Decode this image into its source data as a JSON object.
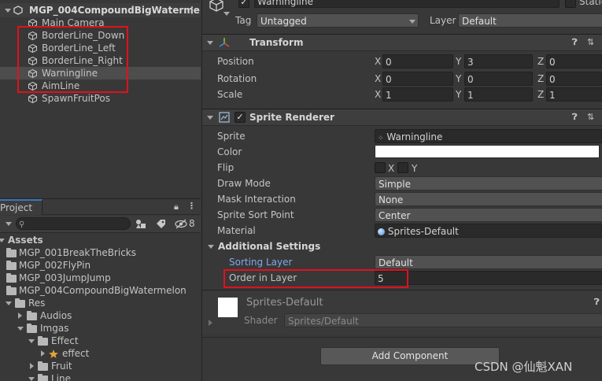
{
  "hierarchy": {
    "root_label": "MGP_004CompoundBigWaterme",
    "items": [
      {
        "label": "Main Camera"
      },
      {
        "label": "BorderLine_Down"
      },
      {
        "label": "BorderLine_Left"
      },
      {
        "label": "BorderLine_Right"
      },
      {
        "label": "Warningline"
      },
      {
        "label": "AimLine"
      },
      {
        "label": "SpawnFruitPos"
      }
    ]
  },
  "project": {
    "tab_label": "Project",
    "search_placeholder": "",
    "badge_count": "8",
    "tree": [
      {
        "label": "Assets"
      },
      {
        "label": "MGP_001BreakTheBricks"
      },
      {
        "label": "MGP_002FlyPin"
      },
      {
        "label": "MGP_003JumpJump"
      },
      {
        "label": "MGP_004CompoundBigWatermelon"
      },
      {
        "label": "Res"
      },
      {
        "label": "Audios"
      },
      {
        "label": "Imgas"
      },
      {
        "label": "Effect"
      },
      {
        "label": "effect"
      },
      {
        "label": "Fruit"
      },
      {
        "label": "Line"
      }
    ]
  },
  "inspector": {
    "object_name": "Warningline",
    "static_label": "Static",
    "tag_label": "Tag",
    "tag_value": "Untagged",
    "layer_label": "Layer",
    "layer_value": "Default",
    "transform": {
      "title": "Transform",
      "rows": [
        {
          "label": "Position",
          "x": "0",
          "y": "3",
          "z": "0"
        },
        {
          "label": "Rotation",
          "x": "0",
          "y": "0",
          "z": "0"
        },
        {
          "label": "Scale",
          "x": "1",
          "y": "1",
          "z": "1"
        }
      ],
      "axis_x": "X",
      "axis_y": "Y",
      "axis_z": "Z"
    },
    "sprite_renderer": {
      "title": "Sprite Renderer",
      "sprite_label": "Sprite",
      "sprite_value": "Warningline",
      "color_label": "Color",
      "flip_label": "Flip",
      "flip_x": "X",
      "flip_y": "Y",
      "draw_mode_label": "Draw Mode",
      "draw_mode_value": "Simple",
      "mask_label": "Mask Interaction",
      "mask_value": "None",
      "sort_point_label": "Sprite Sort Point",
      "sort_point_value": "Center",
      "material_label": "Material",
      "material_value": "Sprites-Default",
      "additional_label": "Additional Settings",
      "sorting_layer_label": "Sorting Layer",
      "sorting_layer_value": "Default",
      "order_label": "Order in Layer",
      "order_value": "5"
    },
    "material_block": {
      "name": "Sprites-Default",
      "shader_label": "Shader",
      "shader_value": "Sprites/Default"
    },
    "add_component_label": "Add Component"
  },
  "watermark": "CSDN @仙魁XAN",
  "colors": {
    "panel_bg": "#383838",
    "field_bg": "#2a2a2a",
    "selection": "#4d4d4d",
    "highlight_red": "#e3101c",
    "link_blue": "#7fa8e8"
  }
}
